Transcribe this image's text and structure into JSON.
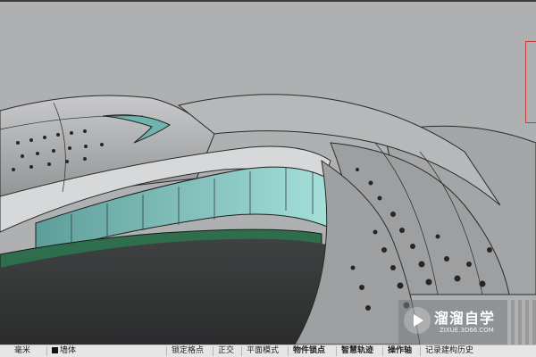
{
  "viewport": {
    "colors": {
      "background": "#aeb0b2",
      "shell": "#a4a6a8",
      "glass": "#7fc7c0",
      "green_ground": "#2f6e4c",
      "dark_floor": "#3a3a3a"
    }
  },
  "statusbar": {
    "unit": "毫米",
    "layer": "墙体",
    "items": [
      "锁定格点",
      "正交",
      "平面模式",
      "物件锁点",
      "智慧轨迹",
      "操作轴",
      "记录建构历史"
    ]
  },
  "watermark": {
    "title": "溜溜自学",
    "url": "ZIXUE.3D66.COM",
    "logo_icon": "play-logo-icon"
  }
}
